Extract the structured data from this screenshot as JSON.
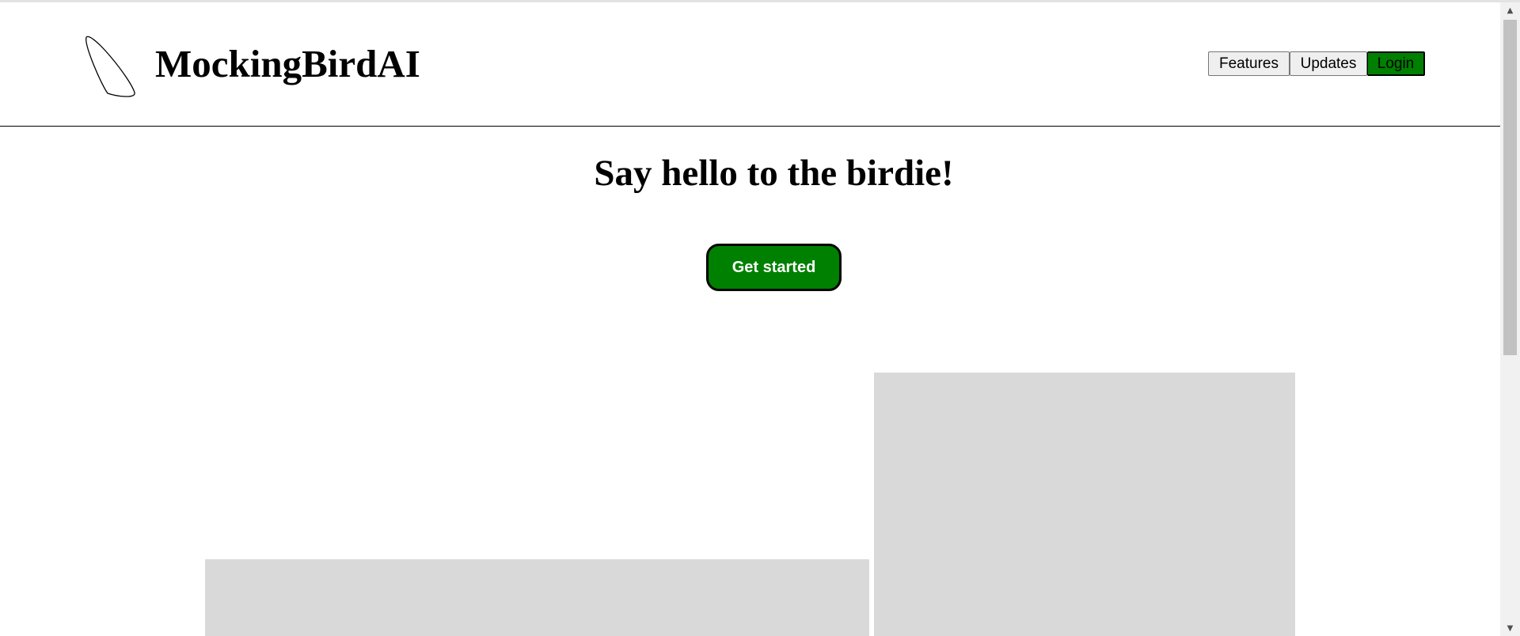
{
  "header": {
    "brand": "MockingBirdAI",
    "logo_icon": "feather-outline-icon",
    "nav": {
      "features_label": "Features",
      "updates_label": "Updates",
      "login_label": "Login"
    }
  },
  "hero": {
    "title": "Say hello to the birdie!",
    "cta_label": "Get started"
  },
  "colors": {
    "accent": "#008000",
    "placeholder": "#d9d9d9",
    "border": "#000000"
  },
  "scrollbar": {
    "up_icon": "triangle-up-icon",
    "down_icon": "triangle-down-icon",
    "up_glyph": "▲",
    "down_glyph": "▼"
  }
}
